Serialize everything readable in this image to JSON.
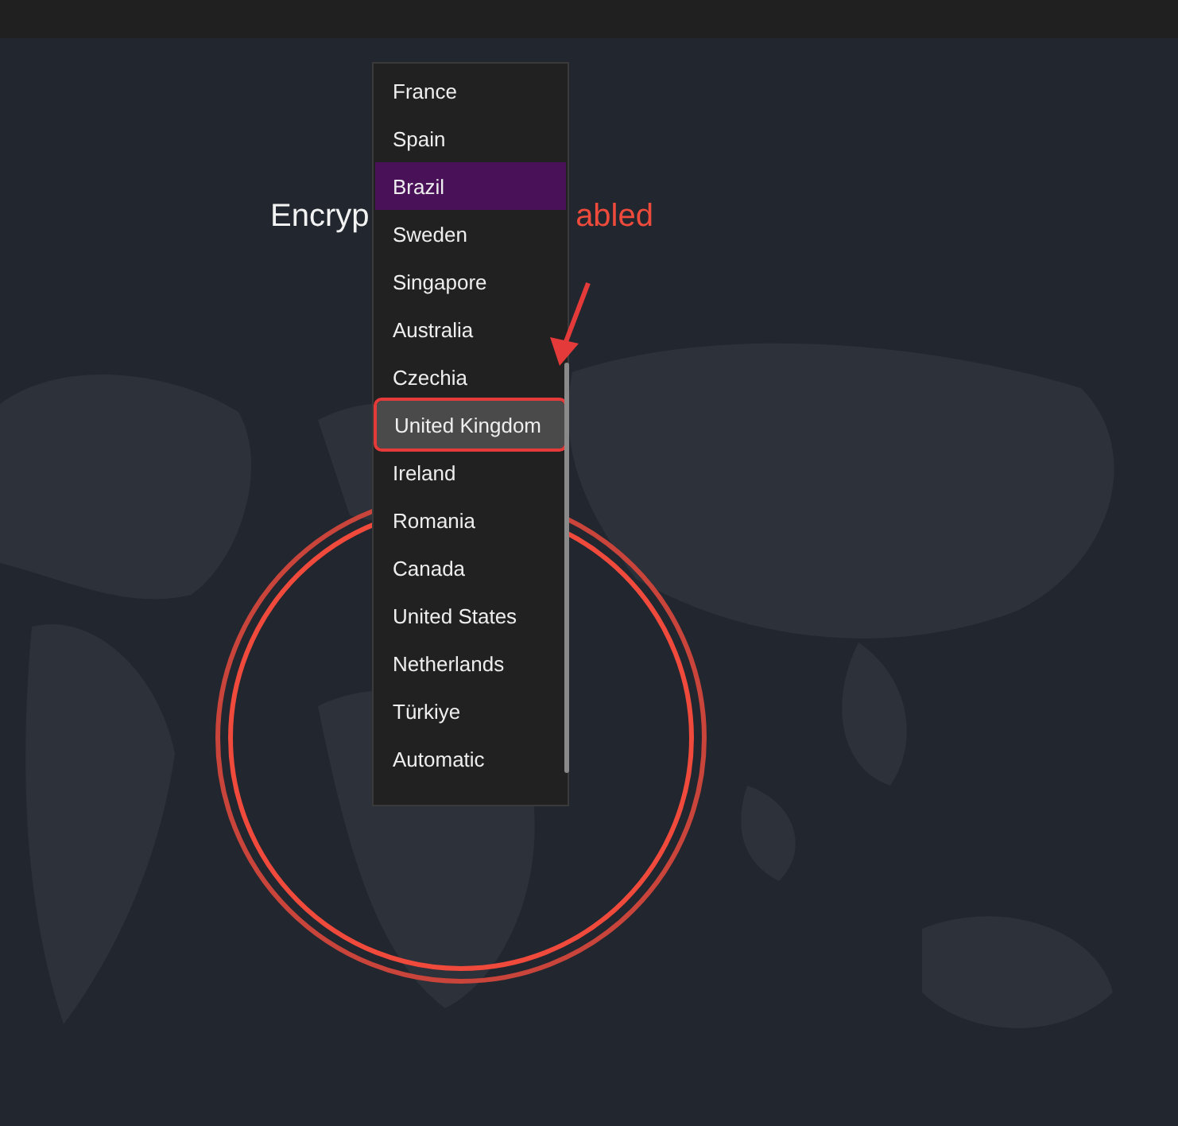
{
  "heading": {
    "parts": [
      {
        "text": "Encryp",
        "kind": "normal"
      },
      {
        "text": "abled",
        "kind": "alert"
      }
    ]
  },
  "dropdown": {
    "items": [
      {
        "label": "France",
        "selected": false,
        "highlighted": false
      },
      {
        "label": "Spain",
        "selected": false,
        "highlighted": false
      },
      {
        "label": "Brazil",
        "selected": true,
        "highlighted": false
      },
      {
        "label": "Sweden",
        "selected": false,
        "highlighted": false
      },
      {
        "label": "Singapore",
        "selected": false,
        "highlighted": false
      },
      {
        "label": "Australia",
        "selected": false,
        "highlighted": false
      },
      {
        "label": "Czechia",
        "selected": false,
        "highlighted": false
      },
      {
        "label": "United Kingdom",
        "selected": false,
        "highlighted": true
      },
      {
        "label": "Ireland",
        "selected": false,
        "highlighted": false
      },
      {
        "label": "Romania",
        "selected": false,
        "highlighted": false
      },
      {
        "label": "Canada",
        "selected": false,
        "highlighted": false
      },
      {
        "label": "United States",
        "selected": false,
        "highlighted": false
      },
      {
        "label": "Netherlands",
        "selected": false,
        "highlighted": false
      },
      {
        "label": "Türkiye",
        "selected": false,
        "highlighted": false
      },
      {
        "label": "Automatic",
        "selected": false,
        "highlighted": false
      }
    ]
  }
}
